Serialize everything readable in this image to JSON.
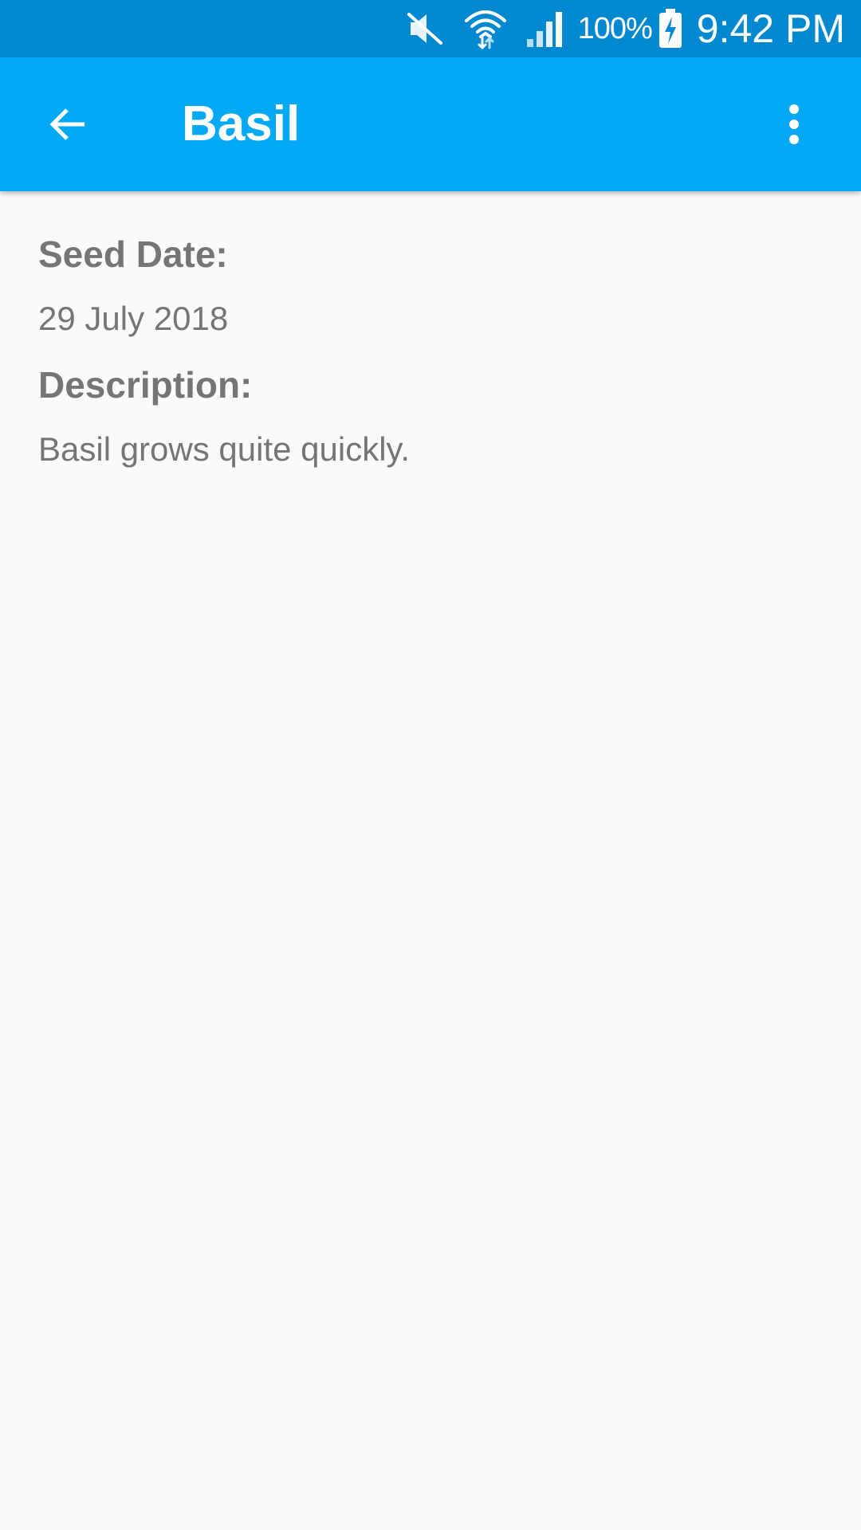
{
  "status_bar": {
    "battery_percent": "100%",
    "time": "9:42 PM",
    "icons": [
      "mute-icon",
      "wifi-icon",
      "signal-icon",
      "battery-charging-icon"
    ]
  },
  "app_bar": {
    "title": "Basil",
    "back_icon": "arrow-back-icon",
    "menu_icon": "more-vert-icon",
    "color": "#03a9f4"
  },
  "details": {
    "seed_date_label": "Seed Date:",
    "seed_date_value": "29 July 2018",
    "description_label": "Description:",
    "description_value": "Basil grows quite quickly."
  },
  "colors": {
    "status_bar": "#0288d1",
    "text": "#757575",
    "background": "#fafafa"
  }
}
